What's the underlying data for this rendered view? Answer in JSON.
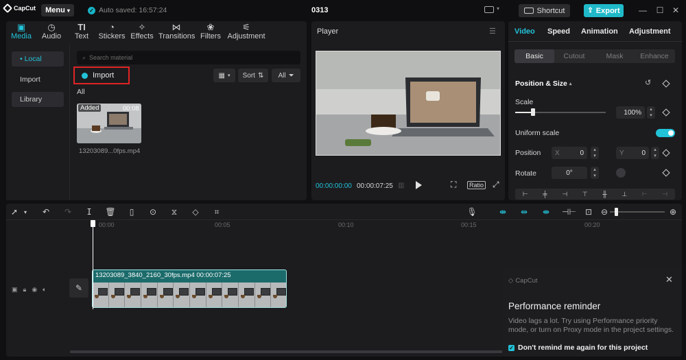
{
  "app": {
    "logo_text": "CapCut",
    "menu_label": "Menu",
    "autosave_text": "Auto saved: 16:57:24",
    "project_title": "0313",
    "shortcut_label": "Shortcut",
    "export_label": "Export",
    "accent_color": "#22c3d8"
  },
  "media": {
    "tabs": [
      {
        "label": "Media",
        "icon": "media-icon"
      },
      {
        "label": "Audio",
        "icon": "audio-icon"
      },
      {
        "label": "Text",
        "icon": "text-icon"
      },
      {
        "label": "Stickers",
        "icon": "stickers-icon"
      },
      {
        "label": "Effects",
        "icon": "effects-icon"
      },
      {
        "label": "Transitions",
        "icon": "transitions-icon"
      },
      {
        "label": "Filters",
        "icon": "filters-icon"
      },
      {
        "label": "Adjustment",
        "icon": "adjustment-icon"
      }
    ],
    "sidebar": [
      {
        "label": "• Local"
      },
      {
        "label": "Import"
      },
      {
        "label": "Library"
      }
    ],
    "search_placeholder": "Search material",
    "import_label": "Import",
    "sort_label": "Sort",
    "all_filter_label": "All",
    "section_label": "All",
    "clip": {
      "badge": "Added",
      "duration": "00:08",
      "filename": "13203089...0fps.mp4"
    }
  },
  "player": {
    "title": "Player",
    "time_current": "00:00:00:00",
    "time_total": "00:00:07:25",
    "ratio_label": "Ratio"
  },
  "inspector": {
    "tabs": [
      "Video",
      "Speed",
      "Animation",
      "Adjustment"
    ],
    "subtabs": [
      "Basic",
      "Cutout",
      "Mask",
      "Enhance"
    ],
    "section_title": "Position & Size",
    "scale_label": "Scale",
    "scale_value": "100%",
    "scale_fraction": 0.2,
    "uniform_label": "Uniform scale",
    "position_label": "Position",
    "x_label": "X",
    "x_value": "0",
    "y_label": "Y",
    "y_value": "0",
    "rotate_label": "Rotate",
    "rotate_value": "0°"
  },
  "timeline": {
    "ticks": [
      "00:00",
      "00:05",
      "00:10",
      "00:15",
      "00:20"
    ],
    "clip_label": "13203089_3840_2160_30fps.mp4   00:00:07:25"
  },
  "reminder": {
    "brand": "CapCut",
    "title": "Performance reminder",
    "body": "Video lags a lot. Try using Performance priority mode, or turn on Proxy mode in the project settings.",
    "checkbox_label": "Don't remind me again for this project"
  }
}
